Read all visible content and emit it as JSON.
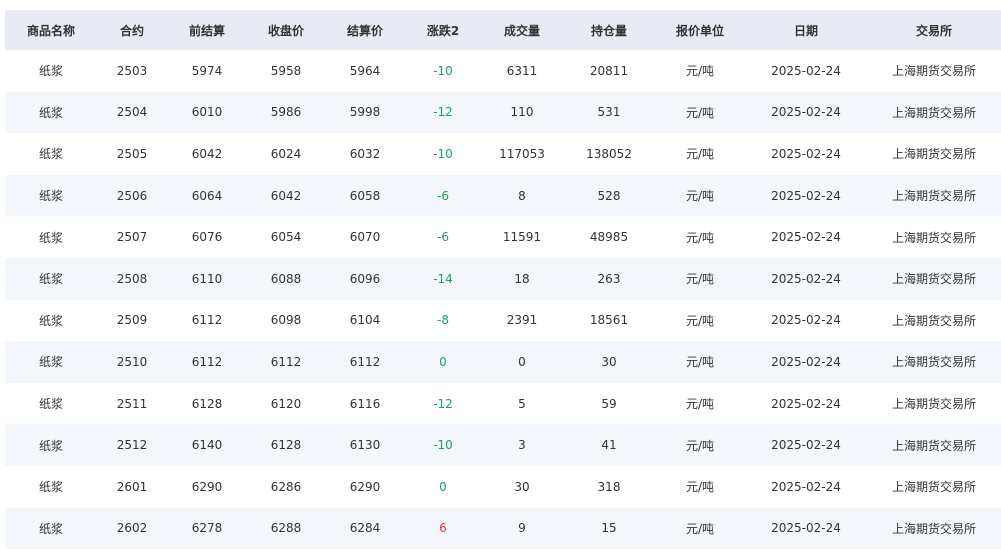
{
  "colors": {
    "header_bg": "#e8ebf3",
    "row_alt_bg": "#f3f7fb",
    "down_or_flat": "#20a060",
    "up": "#e03c3c"
  },
  "table": {
    "columns": [
      "商品名称",
      "合约",
      "前结算",
      "收盘价",
      "结算价",
      "涨跌2",
      "成交量",
      "持仓量",
      "报价单位",
      "日期",
      "交易所"
    ],
    "rows": [
      [
        "纸浆",
        "2503",
        "5974",
        "5958",
        "5964",
        "-10",
        "6311",
        "20811",
        "元/吨",
        "2025-02-24",
        "上海期货交易所"
      ],
      [
        "纸浆",
        "2504",
        "6010",
        "5986",
        "5998",
        "-12",
        "110",
        "531",
        "元/吨",
        "2025-02-24",
        "上海期货交易所"
      ],
      [
        "纸浆",
        "2505",
        "6042",
        "6024",
        "6032",
        "-10",
        "117053",
        "138052",
        "元/吨",
        "2025-02-24",
        "上海期货交易所"
      ],
      [
        "纸浆",
        "2506",
        "6064",
        "6042",
        "6058",
        "-6",
        "8",
        "528",
        "元/吨",
        "2025-02-24",
        "上海期货交易所"
      ],
      [
        "纸浆",
        "2507",
        "6076",
        "6054",
        "6070",
        "-6",
        "11591",
        "48985",
        "元/吨",
        "2025-02-24",
        "上海期货交易所"
      ],
      [
        "纸浆",
        "2508",
        "6110",
        "6088",
        "6096",
        "-14",
        "18",
        "263",
        "元/吨",
        "2025-02-24",
        "上海期货交易所"
      ],
      [
        "纸浆",
        "2509",
        "6112",
        "6098",
        "6104",
        "-8",
        "2391",
        "18561",
        "元/吨",
        "2025-02-24",
        "上海期货交易所"
      ],
      [
        "纸浆",
        "2510",
        "6112",
        "6112",
        "6112",
        "0",
        "0",
        "30",
        "元/吨",
        "2025-02-24",
        "上海期货交易所"
      ],
      [
        "纸浆",
        "2511",
        "6128",
        "6120",
        "6116",
        "-12",
        "5",
        "59",
        "元/吨",
        "2025-02-24",
        "上海期货交易所"
      ],
      [
        "纸浆",
        "2512",
        "6140",
        "6128",
        "6130",
        "-10",
        "3",
        "41",
        "元/吨",
        "2025-02-24",
        "上海期货交易所"
      ],
      [
        "纸浆",
        "2601",
        "6290",
        "6286",
        "6290",
        "0",
        "30",
        "318",
        "元/吨",
        "2025-02-24",
        "上海期货交易所"
      ],
      [
        "纸浆",
        "2602",
        "6278",
        "6288",
        "6284",
        "6",
        "9",
        "15",
        "元/吨",
        "2025-02-24",
        "上海期货交易所"
      ]
    ]
  }
}
